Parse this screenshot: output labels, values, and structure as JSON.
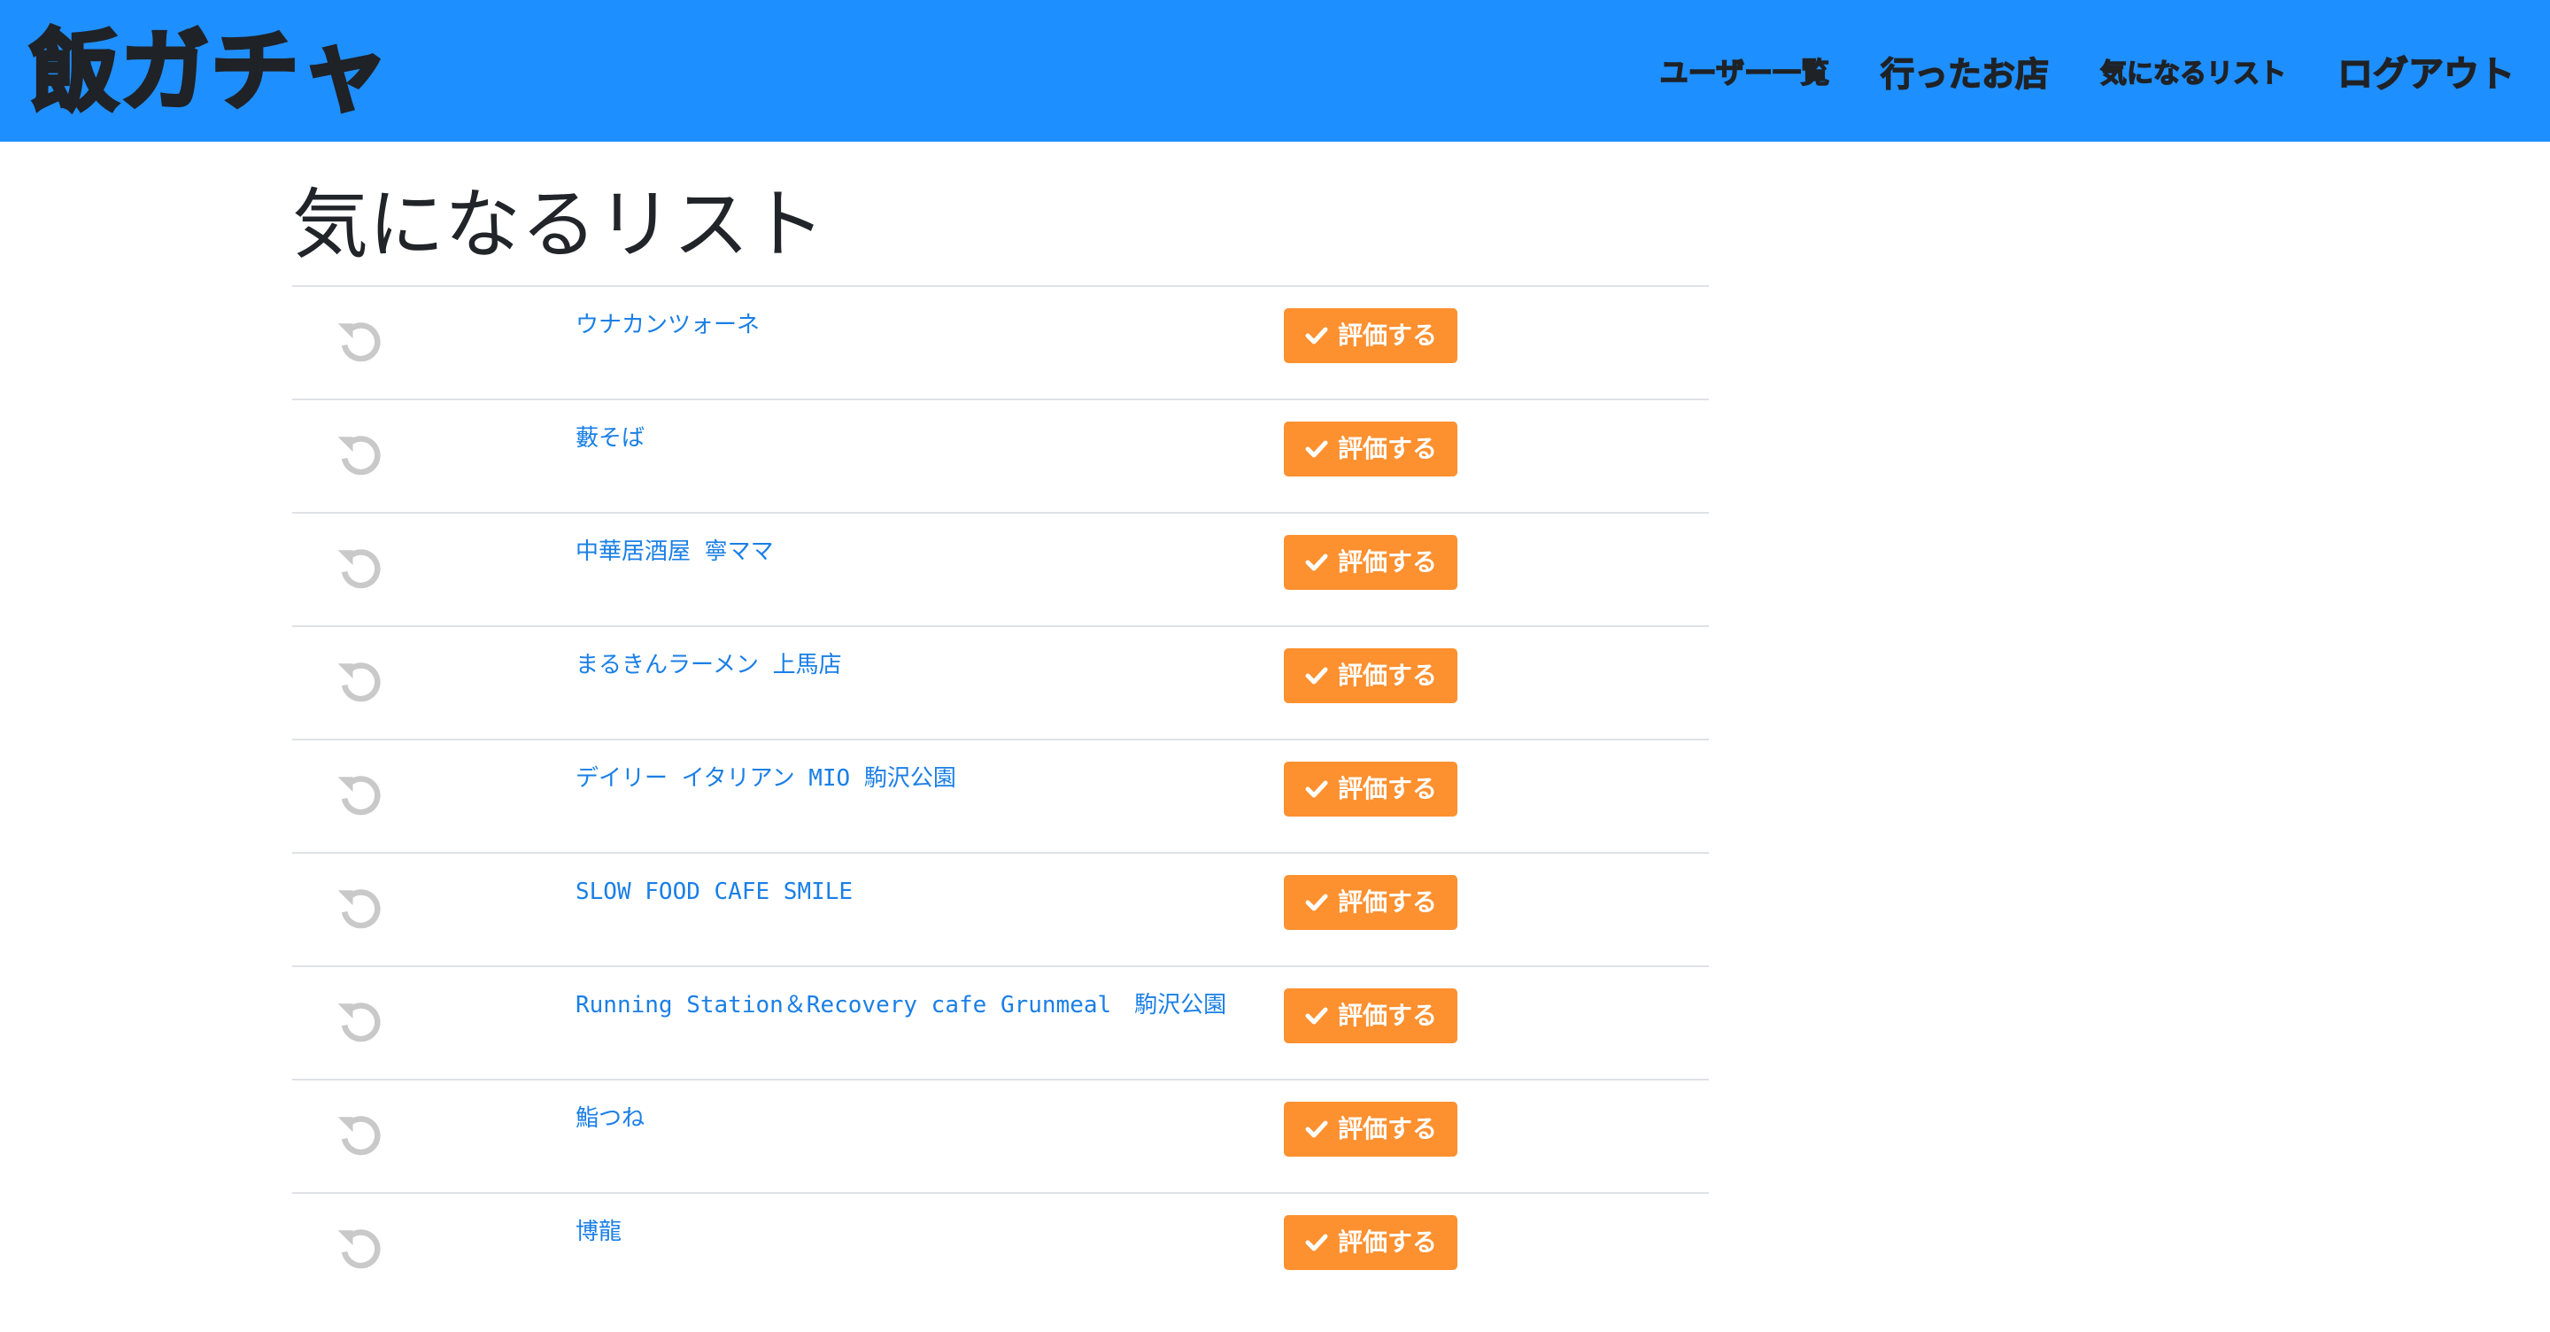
{
  "app": {
    "brand": "飯ガチャ",
    "nav_color": "#1e8fff",
    "accent_button_color": "#fd902f",
    "link_color": "#1a7fe6"
  },
  "nav": {
    "items": [
      {
        "label": "ユーザー一覧"
      },
      {
        "label": "行ったお店"
      },
      {
        "label": "気になるリスト"
      },
      {
        "label": "ログアウト"
      }
    ]
  },
  "page": {
    "title": "気になるリスト"
  },
  "rows": [
    {
      "shop": "ウナカンツォーネ",
      "action": "評価する",
      "icon": "reload-icon"
    },
    {
      "shop": "藪そば",
      "action": "評価する",
      "icon": "reload-icon"
    },
    {
      "shop": "中華居酒屋 寧ママ",
      "action": "評価する",
      "icon": "reload-icon"
    },
    {
      "shop": "まるきんラーメン 上馬店",
      "action": "評価する",
      "icon": "reload-icon"
    },
    {
      "shop": "デイリー イタリアン MIO 駒沢公園",
      "action": "評価する",
      "icon": "reload-icon"
    },
    {
      "shop": "SLOW FOOD CAFE SMILE",
      "action": "評価する",
      "icon": "reload-icon"
    },
    {
      "shop": "Running Station＆Recovery cafe Grunmeal　駒沢公園",
      "action": "評価する",
      "icon": "reload-icon"
    },
    {
      "shop": "鮨つね",
      "action": "評価する",
      "icon": "reload-icon"
    },
    {
      "shop": "博龍",
      "action": "評価する",
      "icon": "reload-icon"
    }
  ]
}
